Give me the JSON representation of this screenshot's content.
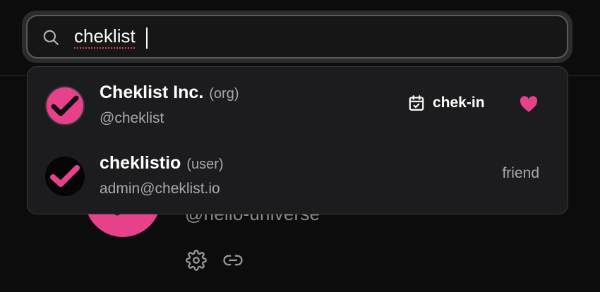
{
  "search": {
    "value": "cheklist"
  },
  "results": [
    {
      "name": "Cheklist Inc.",
      "type": "(org)",
      "sub": "@cheklist",
      "badge_label": "chek-in",
      "badge_icon": "calendar-check-icon",
      "liked": true
    },
    {
      "name": "cheklistio",
      "type": "(user)",
      "sub": "admin@cheklist.io",
      "relation": "friend"
    }
  ],
  "background": {
    "handle": "@hello-universe"
  },
  "colors": {
    "accent": "#e8418c",
    "background": "#0c0c0d",
    "panel": "#1c1c1e"
  }
}
